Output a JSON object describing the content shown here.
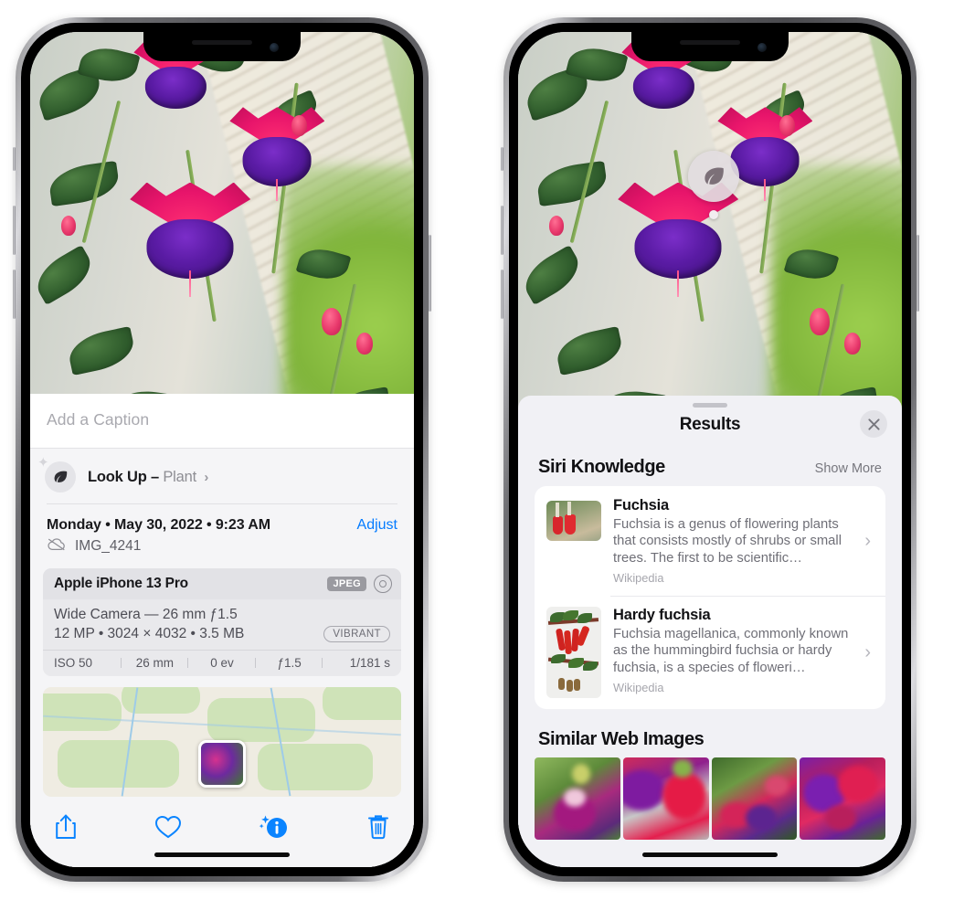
{
  "left_phone": {
    "caption": {
      "placeholder": "Add a Caption",
      "value": ""
    },
    "lookup": {
      "label": "Look Up –",
      "subject": "Plant",
      "chevron": "›",
      "icon": "leaf-icon",
      "sparkle": "✦"
    },
    "meta": {
      "date": "Monday • May 30, 2022 • 9:23 AM",
      "adjust_label": "Adjust",
      "filename": "IMG_4241",
      "cloud_icon": "cloud-slash-icon"
    },
    "camera_card": {
      "model": "Apple iPhone 13 Pro",
      "format_tag": "JPEG",
      "raw_icon": "aperture-icon",
      "lens_line": "Wide Camera — 26 mm ƒ1.5",
      "specs_line": "12 MP • 3024 × 4032 • 3.5 MB",
      "style_tag": "VIBRANT",
      "exif": [
        "ISO 50",
        "26 mm",
        "0 ev",
        "ƒ1.5",
        "1/181 s"
      ]
    },
    "toolbar": [
      {
        "name": "share-button",
        "icon": "share-icon"
      },
      {
        "name": "favorite-button",
        "icon": "heart-icon"
      },
      {
        "name": "info-button",
        "icon": "info-sparkle-icon"
      },
      {
        "name": "delete-button",
        "icon": "trash-icon"
      }
    ]
  },
  "right_phone": {
    "visual_lookup_badge": {
      "icon": "leaf-icon"
    },
    "sheet": {
      "title": "Results",
      "close_label": "✕",
      "sections": [
        {
          "title": "Siri Knowledge",
          "action_label": "Show More",
          "items": [
            {
              "title": "Fuchsia",
              "description": "Fuchsia is a genus of flowering plants that consists mostly of shrubs or small trees. The first to be scientific…",
              "source": "Wikipedia",
              "chevron": "›"
            },
            {
              "title": "Hardy fuchsia",
              "description": "Fuchsia magellanica, commonly known as the hummingbird fuchsia or hardy fuchsia, is a species of floweri…",
              "source": "Wikipedia",
              "chevron": "›"
            }
          ]
        },
        {
          "title": "Similar Web Images",
          "thumbnails": [
            "web-image-1",
            "web-image-2",
            "web-image-3",
            "web-image-4"
          ]
        }
      ]
    }
  },
  "colors": {
    "accent_blue": "#0a84ff",
    "sheet_bg": "#f1f1f5",
    "card_white": "#ffffff",
    "secondary_text": "#77777e"
  }
}
